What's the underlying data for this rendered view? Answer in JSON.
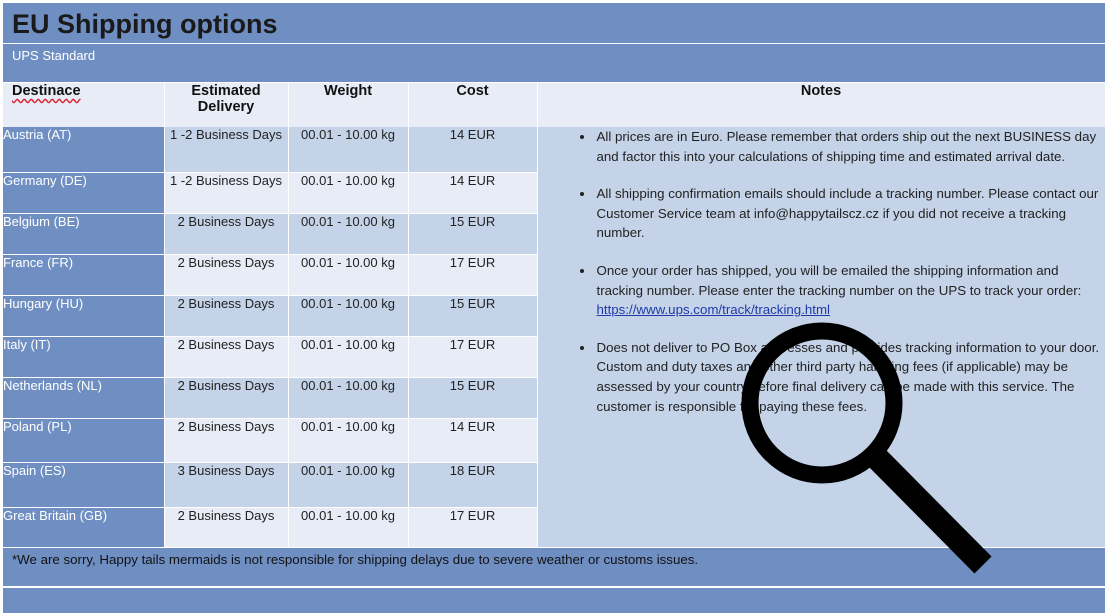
{
  "title": "EU Shipping options",
  "subtitle": "UPS Standard",
  "headers": {
    "destination": "Destinace",
    "delivery": "Estimated Delivery",
    "weight": "Weight",
    "cost": "Cost",
    "notes": "Notes"
  },
  "rows": [
    {
      "country": "Austria (AT)",
      "delivery": "1 -2 Business Days",
      "weight": "00.01 - 10.00 kg",
      "cost": "14 EUR"
    },
    {
      "country": "Germany (DE)",
      "delivery": "1 -2 Business Days",
      "weight": "00.01 - 10.00 kg",
      "cost": "14 EUR"
    },
    {
      "country": "Belgium (BE)",
      "delivery": "2 Business Days",
      "weight": "00.01 - 10.00 kg",
      "cost": "15 EUR"
    },
    {
      "country": "France (FR)",
      "delivery": "2 Business Days",
      "weight": "00.01 - 10.00 kg",
      "cost": "17 EUR"
    },
    {
      "country": "Hungary (HU)",
      "delivery": "2 Business Days",
      "weight": "00.01 - 10.00 kg",
      "cost": "15 EUR"
    },
    {
      "country": "Italy (IT)",
      "delivery": "2 Business Days",
      "weight": "00.01 - 10.00 kg",
      "cost": "17 EUR"
    },
    {
      "country": "Netherlands (NL)",
      "delivery": "2 Business Days",
      "weight": "00.01 - 10.00 kg",
      "cost": "15 EUR"
    },
    {
      "country": "Poland (PL)",
      "delivery": "2 Business Days",
      "weight": "00.01 - 10.00 kg",
      "cost": "14 EUR"
    },
    {
      "country": "Spain (ES)",
      "delivery": "3 Business Days",
      "weight": "00.01 - 10.00 kg",
      "cost": "18 EUR"
    },
    {
      "country": "Great Britain (GB)",
      "delivery": "2 Business Days",
      "weight": "00.01 - 10.00 kg",
      "cost": "17 EUR"
    }
  ],
  "notes": [
    {
      "text": "All prices are in Euro. Please remember that orders ship out the next BUSINESS day and factor this into your calculations of shipping time and estimated arrival date."
    },
    {
      "text": "All shipping confirmation emails should include a tracking number. Please contact our Customer Service team at info@happytailscz.cz if you did not receive a tracking number."
    },
    {
      "text": "Once your order has shipped, you will be emailed the shipping information and tracking number. Please enter the tracking number on the UPS to track your order:",
      "link": "https://www.ups.com/track/tracking.html"
    },
    {
      "text": "Does not deliver to PO Box addresses and provides tracking information to your door. Custom and duty taxes and other third party handling fees (if applicable) may be assessed by your country before final delivery can be made with this service. The customer is responsible for paying these fees."
    }
  ],
  "footer": "*We are sorry, Happy tails mermaids is not responsible for shipping delays due to severe weather or customs issues.",
  "overlay_icon": "magnifying-glass-icon",
  "colors": {
    "band": "#6f8fc3",
    "light_cell": "#c4d3e8",
    "pale_cell": "#e8ecf6",
    "link": "#1f3aa8"
  }
}
